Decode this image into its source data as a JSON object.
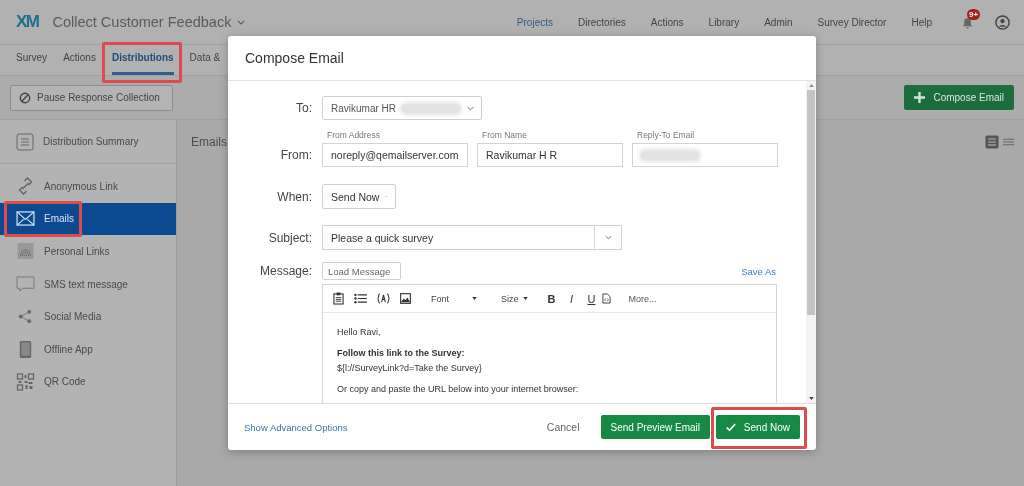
{
  "app": {
    "logo": "XM",
    "project_title": "Collect Customer Feedback"
  },
  "top_nav": [
    {
      "label": "Projects",
      "selected": true
    },
    {
      "label": "Directories",
      "selected": false
    },
    {
      "label": "Actions",
      "selected": false
    },
    {
      "label": "Library",
      "selected": false
    },
    {
      "label": "Admin",
      "selected": false
    },
    {
      "label": "Survey Director",
      "selected": false
    },
    {
      "label": "Help",
      "selected": false
    }
  ],
  "notifications": {
    "badge": "9+"
  },
  "tabs": [
    {
      "label": "Survey",
      "selected": false,
      "highlighted": false
    },
    {
      "label": "Actions",
      "selected": false,
      "highlighted": false
    },
    {
      "label": "Distributions",
      "selected": true,
      "highlighted": true
    },
    {
      "label": "Data &",
      "selected": false,
      "highlighted": false
    }
  ],
  "toolbar": {
    "pause_button": "Pause Response Collection",
    "compose_button": "Compose Email"
  },
  "sidebar": {
    "summary": "Distribution Summary",
    "items": [
      {
        "label": "Anonymous Link",
        "selected": false,
        "highlighted": false
      },
      {
        "label": "Emails",
        "selected": true,
        "highlighted": true
      },
      {
        "label": "Personal Links",
        "selected": false,
        "highlighted": false
      },
      {
        "label": "SMS text message",
        "selected": false,
        "highlighted": false
      },
      {
        "label": "Social Media",
        "selected": false,
        "highlighted": false
      },
      {
        "label": "Offline App",
        "selected": false,
        "highlighted": false
      },
      {
        "label": "QR Code",
        "selected": false,
        "highlighted": false
      }
    ]
  },
  "main": {
    "heading": "Emails"
  },
  "dialog": {
    "title": "Compose Email",
    "to": {
      "label": "To:",
      "value": "Ravikumar HR",
      "redacted": true
    },
    "from": {
      "label": "From:",
      "fields": [
        {
          "caption": "From Address",
          "value": "noreply@qemailserver.com",
          "redacted": false
        },
        {
          "caption": "From Name",
          "value": "Ravikumar H R",
          "redacted": false
        },
        {
          "caption": "Reply-To Email",
          "redacted": true
        }
      ]
    },
    "when": {
      "label": "When:",
      "value": "Send Now"
    },
    "subject": {
      "label": "Subject:",
      "value": "Please a quick survey"
    },
    "message": {
      "label": "Message:",
      "load": "Load Message",
      "save_as": "Save As",
      "toolbar": [
        {
          "kind": "icon"
        },
        {
          "kind": "icon"
        },
        {
          "kind": "icon"
        },
        {
          "kind": "icon"
        },
        {
          "kind": "dropdown",
          "label": "Font"
        },
        {
          "kind": "dropdown",
          "label": "Size"
        },
        {
          "kind": "format",
          "label": "B"
        },
        {
          "kind": "format",
          "label": "I"
        },
        {
          "kind": "format",
          "label": "U"
        },
        {
          "kind": "icon"
        },
        {
          "kind": "link",
          "label": "More..."
        }
      ],
      "paragraphs": [
        {
          "lines": [
            {
              "text": "Hello Ravi,",
              "bold": false
            }
          ]
        },
        {
          "lines": [
            {
              "text": "Follow this link to the Survey:",
              "bold": true
            },
            {
              "text": "${l://SurveyLink?d=Take the Survey}",
              "bold": false
            }
          ]
        },
        {
          "lines": [
            {
              "text": "Or copy and paste the URL below into your internet browser:",
              "bold": false
            }
          ]
        }
      ]
    },
    "footer": {
      "advanced": "Show Advanced Options",
      "cancel": "Cancel",
      "buttons": [
        {
          "label": "Send Preview Email",
          "check": false,
          "highlighted": false
        },
        {
          "label": "Send Now",
          "check": true,
          "highlighted": true
        }
      ]
    }
  }
}
